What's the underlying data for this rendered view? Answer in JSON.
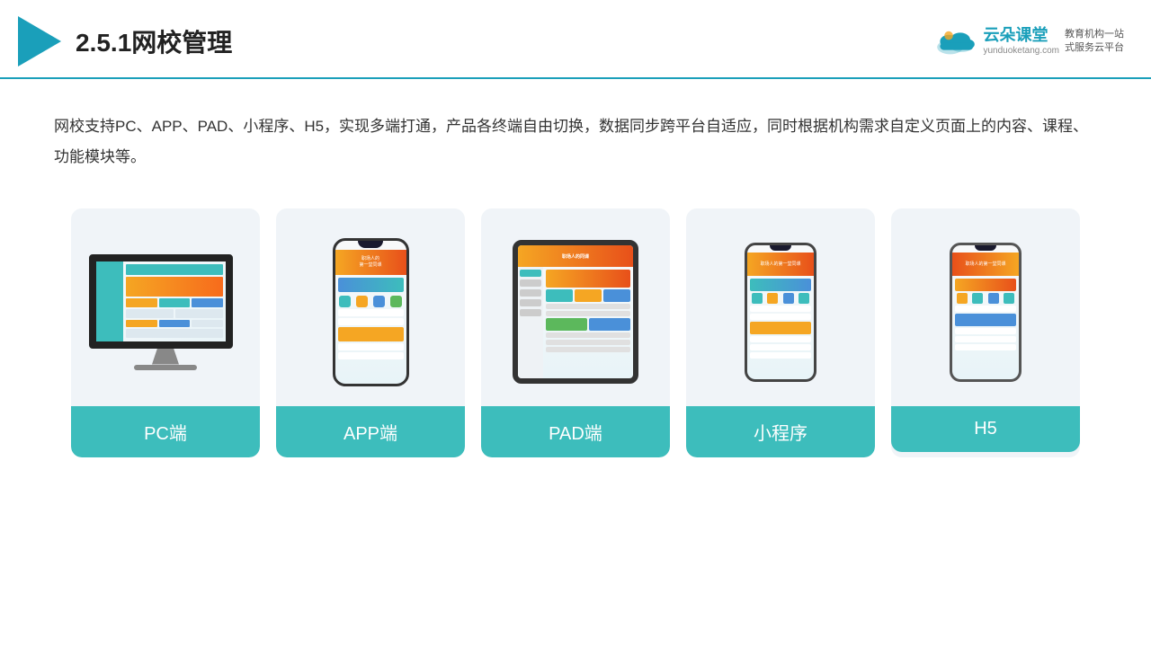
{
  "header": {
    "title_prefix": "2.5.1",
    "title_main": "网校管理",
    "brand_name": "云朵课堂",
    "brand_url": "yunduoketang.com",
    "brand_tagline": "教育机构一站\n式服务云平台"
  },
  "description": {
    "text": "网校支持PC、APP、PAD、小程序、H5，实现多端打通，产品各终端自由切换，数据同步跨平台自适应，同时根据机构需求自定义页面上的内容、课程、功能模块等。"
  },
  "cards": [
    {
      "id": "pc",
      "label": "PC端"
    },
    {
      "id": "app",
      "label": "APP端"
    },
    {
      "id": "pad",
      "label": "PAD端"
    },
    {
      "id": "miniprogram",
      "label": "小程序"
    },
    {
      "id": "h5",
      "label": "H5"
    }
  ],
  "colors": {
    "teal": "#3dbdbc",
    "accent_orange": "#f5a623",
    "header_border": "#1a9fba"
  }
}
